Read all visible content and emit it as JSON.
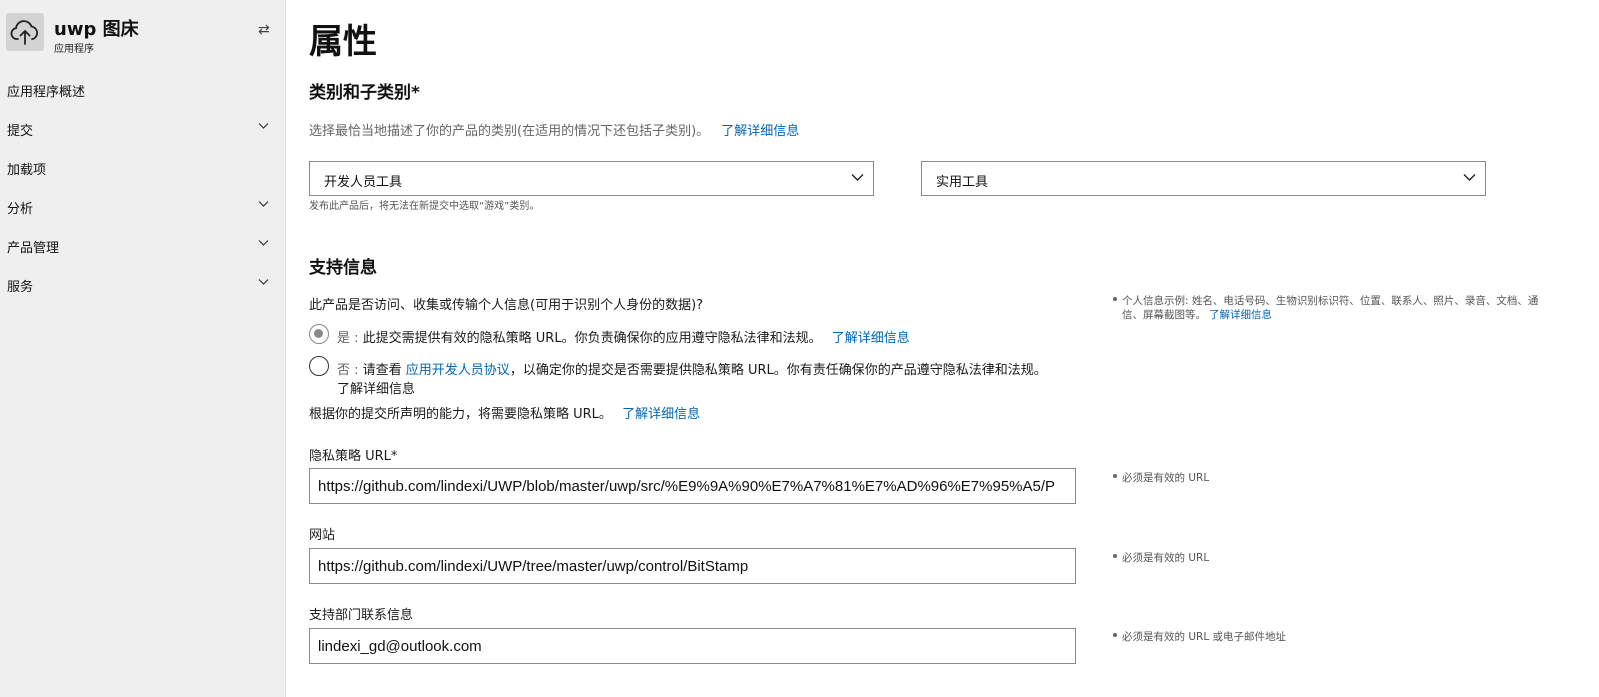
{
  "sidebar": {
    "app_name": "uwp 图床",
    "app_subtitle": "应用程序",
    "app_icon": "cloud-upload-icon",
    "swap_icon": "⇄",
    "items": [
      {
        "label": "应用程序概述",
        "expandable": false
      },
      {
        "label": "提交",
        "expandable": true
      },
      {
        "label": "加载项",
        "expandable": false
      },
      {
        "label": "分析",
        "expandable": true
      },
      {
        "label": "产品管理",
        "expandable": true
      },
      {
        "label": "服务",
        "expandable": true
      }
    ]
  },
  "main": {
    "title": "属性",
    "category": {
      "heading": "类别和子类别*",
      "description": "选择最恰当地描述了你的产品的类别(在适用的情况下还包括子类别)。",
      "learn_more": "了解详细信息",
      "category_value": "开发人员工具",
      "subcategory_value": "实用工具",
      "note": "发布此产品后，将无法在新提交中选取“游戏”类别。"
    },
    "support": {
      "heading": "支持信息",
      "question": "此产品是否访问、收集或传输个人信息(可用于识别个人身份的数据)?",
      "yes_prefix": "是 : ",
      "yes_text": "此提交需提供有效的隐私策略 URL。你负责确保你的应用遵守隐私法律和法规。",
      "yes_learn_more": "了解详细信息",
      "no_prefix": "否 : ",
      "no_text_before": "请查看 ",
      "no_link": "应用开发人员协议",
      "no_text_after": "，以确定你的提交是否需要提供隐私策略 URL。你有责任确保你的产品遵守隐私法律和法规。",
      "no_learn_more": "了解详细信息",
      "capability_text": "根据你的提交所声明的能力，将需要隐私策略 URL。",
      "capability_learn_more": "了解详细信息",
      "side_note_line1": "个人信息示例: 姓名、电话号码、生物识别标识符、位置、联系人、照片、录音、文档、通",
      "side_note_line2": "信、屏幕截图等。",
      "side_note_link": "了解详细信息",
      "selected": "yes"
    },
    "fields": {
      "privacy_label": "隐私策略 URL*",
      "privacy_value": "https://github.com/lindexi/UWP/blob/master/uwp/src/%E9%9A%90%E7%A7%81%E7%AD%96%E7%95%A5/P",
      "privacy_hint": "必须是有效的 URL",
      "website_label": "网站",
      "website_value": "https://github.com/lindexi/UWP/tree/master/uwp/control/BitStamp",
      "website_hint": "必须是有效的 URL",
      "contact_label": "支持部门联系信息",
      "contact_value": "lindexi_gd@outlook.com",
      "contact_hint": "必须是有效的 URL 或电子邮件地址"
    }
  }
}
